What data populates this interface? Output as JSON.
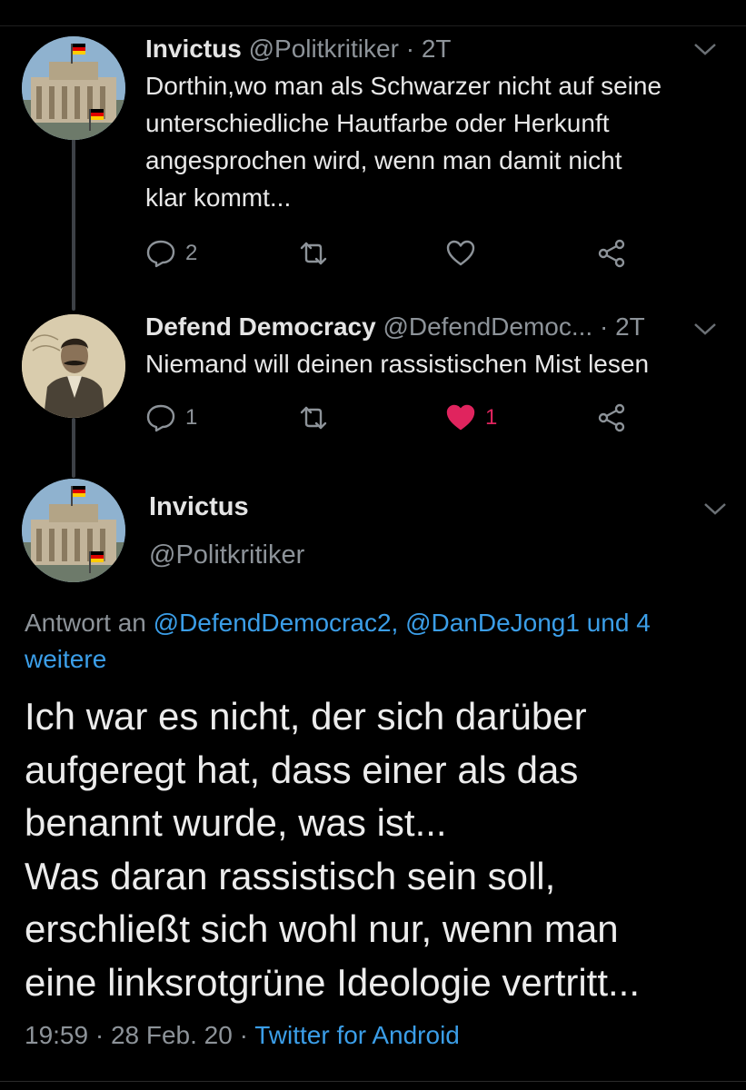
{
  "tweets": [
    {
      "name": "Invictus",
      "handle": "@Politkritiker",
      "time": "· 2T",
      "text_lines": [
        "Dorthin,wo man als Schwarzer nicht auf seine",
        "unterschiedliche Hautfarbe oder Herkunft",
        "angesprochen wird, wenn man damit nicht",
        "klar kommt..."
      ],
      "replies": "2",
      "likes": "",
      "liked": false
    },
    {
      "name": "Defend Democracy",
      "handle": "@DefendDemoc...",
      "time": "· 2T",
      "text_lines": [
        "Niemand will deinen rassistischen Mist lesen"
      ],
      "replies": "1",
      "likes": "1",
      "liked": true
    }
  ],
  "main": {
    "name": "Invictus",
    "handle": "@Politkritiker",
    "reply_prefix": "Antwort an ",
    "mention_1": "@DefendDemocrac2,",
    "mention_2": "@DanDeJong1",
    "reply_more": "und 4 weitere",
    "text_lines": [
      "Ich war es nicht, der sich darüber",
      "aufgeregt hat, dass einer als das",
      "benannt wurde, was ist...",
      "Was daran rassistisch sein soll,",
      "erschließt sich wohl nur, wenn man",
      "eine linksrotgrüne Ideologie vertritt..."
    ],
    "timestamp": "19:59 · 28 Feb. 20 · ",
    "source": "Twitter for Android"
  },
  "icons": [
    "reply-icon",
    "retweet-icon",
    "like-icon",
    "share-icon",
    "chevron-down-icon"
  ],
  "colors": {
    "background": "#000000",
    "link": "#3b9ee8",
    "like_active": "#e0245e",
    "muted": "#8d9399"
  }
}
